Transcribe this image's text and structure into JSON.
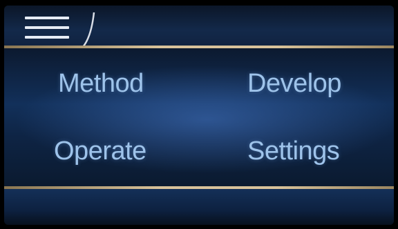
{
  "header": {
    "menu_icon": "hamburger-menu-icon"
  },
  "menu": {
    "method": "Method",
    "develop": "Develop",
    "operate": "Operate",
    "settings": "Settings"
  },
  "colors": {
    "accent_gold": "#d8c29a",
    "label_blue": "#9ec3ea",
    "background_blue": "#12305a"
  }
}
